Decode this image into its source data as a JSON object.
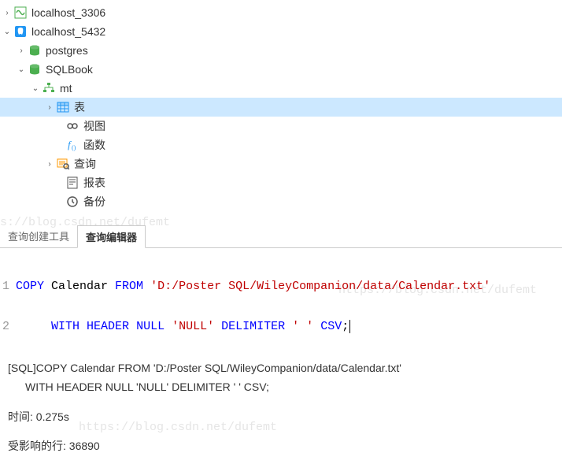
{
  "tree": {
    "localhost_3306": "localhost_3306",
    "localhost_5432": "localhost_5432",
    "postgres": "postgres",
    "sqlbook": "SQLBook",
    "mt": "mt",
    "tables": "表",
    "views": "视图",
    "functions": "函数",
    "queries": "查询",
    "reports": "报表",
    "backups": "备份"
  },
  "tabs": {
    "builder": "查询创建工具",
    "editor": "查询编辑器"
  },
  "sql": {
    "line1": {
      "num": "1",
      "copy": "COPY",
      "tbl": " Calendar ",
      "from": "FROM",
      "sp": " ",
      "path": "'D:/Poster SQL/WileyCompanion/data/Calendar.txt'"
    },
    "line2": {
      "num": "2",
      "pad": "     ",
      "with": "WITH",
      "sp1": " ",
      "header": "HEADER",
      "sp2": " ",
      "null": "NULL",
      "sp3": " ",
      "nullstr": "'NULL'",
      "sp4": " ",
      "delim": "DELIMITER",
      "sp5": " ",
      "delimstr": "' '",
      "sp6": " ",
      "csv": "CSV",
      "semi": ";"
    }
  },
  "output": {
    "line1": "[SQL]COPY Calendar FROM 'D:/Poster SQL/WileyCompanion/data/Calendar.txt'",
    "line2": "WITH HEADER NULL 'NULL' DELIMITER '             ' CSV;",
    "time": "时间: 0.275s",
    "affected": "受影响的行: 36890"
  },
  "watermarks": {
    "w1": "s://blog.csdn.net/dufemt",
    "w2": "https://blog.csdn.net/dufemt",
    "w3": "https://blog.csdn.net/dufemt"
  },
  "arrows": {
    "right": "›",
    "down": "⌄"
  }
}
